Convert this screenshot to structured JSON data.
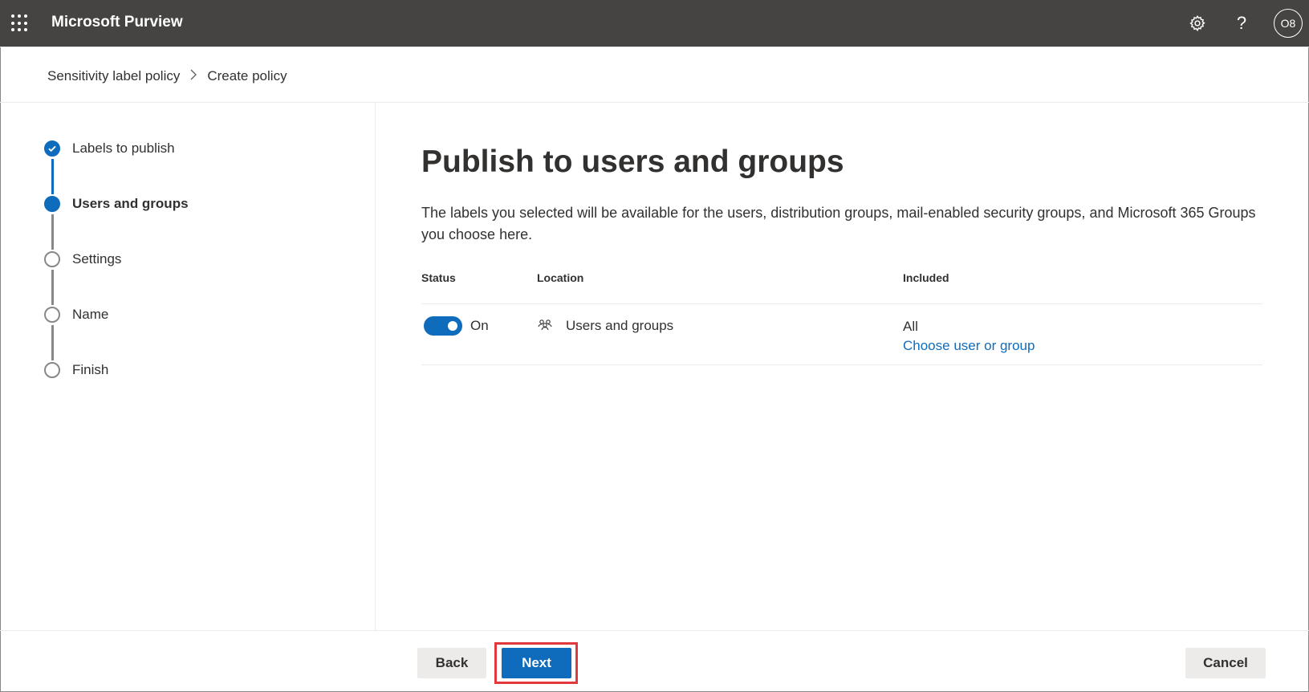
{
  "header": {
    "app_title": "Microsoft Purview",
    "icons": [
      "app-launcher-icon",
      "gear-icon",
      "help-icon"
    ],
    "help_glyph": "?",
    "avatar_initials": "O8"
  },
  "breadcrumb": {
    "items": [
      "Sensitivity label policy",
      "Create policy"
    ]
  },
  "stepper": {
    "steps": [
      {
        "label": "Labels to publish",
        "state": "completed"
      },
      {
        "label": "Users and groups",
        "state": "current"
      },
      {
        "label": "Settings",
        "state": "pending"
      },
      {
        "label": "Name",
        "state": "pending"
      },
      {
        "label": "Finish",
        "state": "pending"
      }
    ]
  },
  "main": {
    "title": "Publish to users and groups",
    "description": "The labels you selected will be available for the users, distribution groups, mail-enabled security groups, and Microsoft 365 Groups you choose here.",
    "table": {
      "columns": [
        "Status",
        "Location",
        "Included"
      ],
      "rows": [
        {
          "status_toggle_on": true,
          "status_text": "On",
          "location": "Users and groups",
          "location_icon": "users-icon",
          "included_value": "All",
          "included_link": "Choose user or group"
        }
      ]
    }
  },
  "footer": {
    "back_label": "Back",
    "next_label": "Next",
    "cancel_label": "Cancel"
  },
  "colors": {
    "topbar": "#464442",
    "accent": "#0f6cbd",
    "highlight": "#e0383c"
  }
}
